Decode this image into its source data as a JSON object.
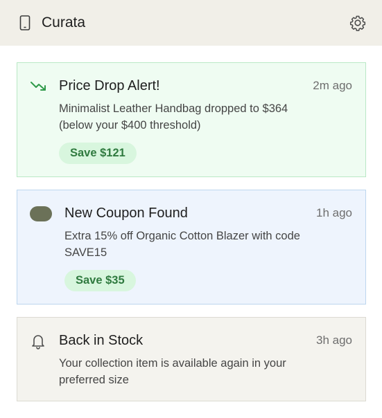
{
  "app": {
    "title": "Curata",
    "icon": "phone-icon",
    "settings_icon": "gear-icon"
  },
  "notifications": [
    {
      "type": "price-drop",
      "icon": "trending-down-icon",
      "title": "Price Drop Alert!",
      "time": "2m ago",
      "description_line1": "Minimalist Leather Handbag dropped to $364",
      "description_line2": "(below your $400 threshold)",
      "badge": "Save $121",
      "background": "#effcf2",
      "border": "#b9e8c5"
    },
    {
      "type": "coupon",
      "icon": "coupon-pill-icon",
      "title": "New Coupon Found",
      "time": "1h ago",
      "description_line1": "Extra 15% off Organic Cotton Blazer with code",
      "description_line2": "SAVE15",
      "badge": "Save $35",
      "background": "#eef4fd",
      "border": "#bcd6ee"
    },
    {
      "type": "back-in-stock",
      "icon": "bell-icon",
      "title": "Back in Stock",
      "time": "3h ago",
      "description_line1": "Your collection item is available again in your",
      "description_line2": "preferred size",
      "background": "#f4f3ee",
      "border": "#dcdad2"
    }
  ],
  "colors": {
    "topbar_bg": "#f1efe8",
    "badge_bg": "#d8f6de",
    "badge_text": "#2f7a3f",
    "trend_icon": "#2f9a4a",
    "coupon_pill": "#6b7158"
  }
}
